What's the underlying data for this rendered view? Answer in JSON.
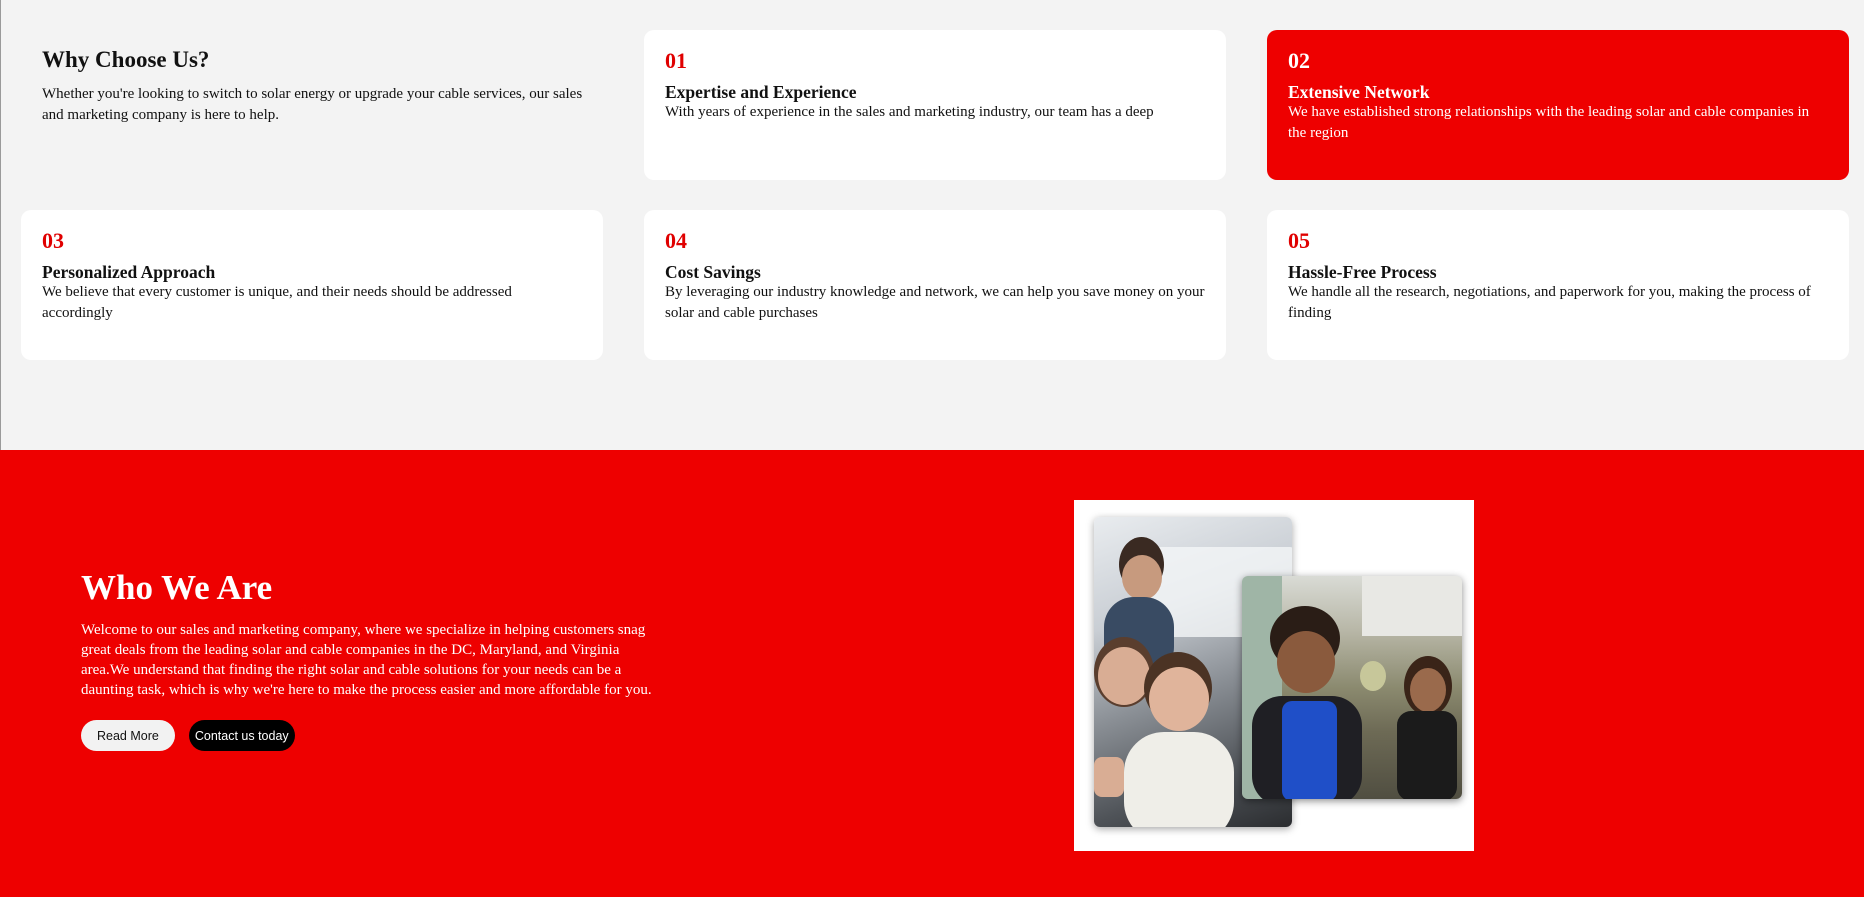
{
  "why": {
    "heading": "Why Choose Us?",
    "intro": "Whether you're looking to switch to solar energy or upgrade your cable services, our sales and marketing company is here to help.",
    "cards": [
      {
        "num": "01",
        "title": "Expertise and Experience",
        "desc": "With years of experience in the sales and marketing industry, our team has a deep",
        "highlight": false
      },
      {
        "num": "02",
        "title": "Extensive Network",
        "desc": "We have established strong relationships with the leading solar and cable companies in the region",
        "highlight": true
      },
      {
        "num": "03",
        "title": "Personalized Approach",
        "desc": "We believe that every customer is unique, and their needs should be addressed accordingly",
        "highlight": false
      },
      {
        "num": "04",
        "title": "Cost Savings",
        "desc": "By leveraging our industry knowledge and network, we can help you save money on your solar and cable purchases",
        "highlight": false
      },
      {
        "num": "05",
        "title": "Hassle-Free Process",
        "desc": "We handle all the research, negotiations, and paperwork for you, making the process of finding",
        "highlight": false
      }
    ]
  },
  "who": {
    "heading": "Who We Are",
    "body": "Welcome to our sales and marketing company, where we specialize in helping customers snag great deals from the leading solar and cable companies in the DC, Maryland, and Virginia area.We understand that finding the right solar and cable solutions for your needs can be a daunting task, which is why we're here to make the process easier and more affordable for you.",
    "read_more_label": "Read More",
    "contact_label": "Contact us today"
  },
  "colors": {
    "brand_red": "#ee0000",
    "number_red": "#e00000",
    "section_bg": "#f3f3f3",
    "card_bg": "#ffffff"
  }
}
